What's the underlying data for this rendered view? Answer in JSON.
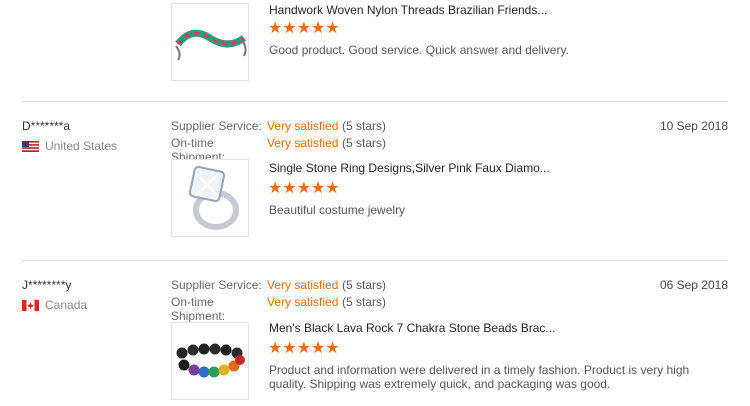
{
  "labels": {
    "supplier_service": "Supplier Service:",
    "shipment": "On-time Shipment:"
  },
  "reviews": [
    {
      "product_title": "Handwork Woven Nylon Threads Brazilian Friends...",
      "rating": "★★★★★",
      "feedback": "Good product. Good service. Quick answer and delivery."
    },
    {
      "reviewer": "D*******a",
      "country": "United States",
      "supplier_value": "Very satisfied",
      "supplier_stars": "(5 stars)",
      "shipment_value": "Very satisfied",
      "shipment_stars": "(5 stars)",
      "date": "10 Sep 2018",
      "product_title": "Single Stone Ring Designs,Silver Pink Faux Diamo...",
      "rating": "★★★★★",
      "feedback": "Beautiful costume jewelry"
    },
    {
      "reviewer": "J********y",
      "country": "Canada",
      "supplier_value": "Very satisfied",
      "supplier_stars": "(5 stars)",
      "shipment_value": "Very satisfied",
      "shipment_stars": "(5 stars)",
      "date": "06 Sep 2018",
      "product_title": "Men's Black Lava Rock 7 Chakra Stone Beads Brac...",
      "rating": "★★★★★",
      "feedback": "Product and information were delivered in a timely fashion. Product is very high quality. Shipping was extremely quick, and packaging was good."
    }
  ],
  "colors": {
    "accent": "#f46a00",
    "divider": "#dddddd"
  },
  "icons": [
    "us-flag-icon",
    "canada-flag-icon",
    "star-icon"
  ]
}
